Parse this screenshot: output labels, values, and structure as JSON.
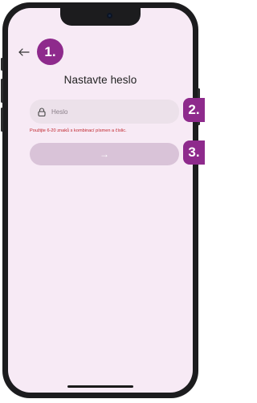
{
  "screen": {
    "title": "Nastavte heslo",
    "password_field": {
      "placeholder": "Heslo",
      "value": ""
    },
    "hint": "Použijte 6-20 znaků s kombinací písmen a číslic.",
    "submit_label": "→"
  },
  "annotations": {
    "step_1": "1.",
    "step_2": "2.",
    "step_3": "3."
  },
  "icons": {
    "back": "arrow-left-icon",
    "password": "lock-icon",
    "camera": "camera-icon"
  },
  "colors": {
    "screen_background": "#f7eaf5",
    "input_background": "#ece1ea",
    "button_disabled": "#d9c3d8",
    "hint_text": "#c0262d",
    "badge": "#8e2a8c"
  }
}
